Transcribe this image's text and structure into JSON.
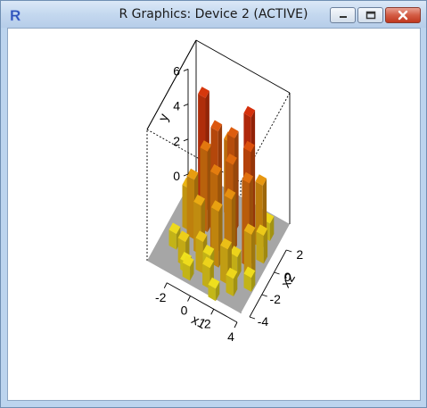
{
  "window": {
    "title": "R Graphics: Device 2 (ACTIVE)",
    "icon": "r-logo-icon",
    "controls": [
      "minimize-icon",
      "maximize-icon",
      "close-icon"
    ]
  },
  "chart_data": {
    "type": "3d-bar",
    "xlabel": "x1",
    "ylabel": "x2",
    "zlabel": "y",
    "x_ticks": [
      "-2",
      "0",
      "2",
      "4"
    ],
    "y_ticks": [
      "-4",
      "-2",
      "0",
      "2"
    ],
    "z_ticks": [
      "0",
      "2",
      "4",
      "6"
    ],
    "zlim": [
      0,
      7
    ],
    "colors": {
      "low": "#f0f020",
      "mid": "#e89a10",
      "high": "#d42a0c",
      "floor": "#a6a6a6"
    },
    "bars": [
      {
        "x1": -2.2,
        "x2": 1.8,
        "y": 6.6
      },
      {
        "x1": 1.6,
        "x2": 2.0,
        "y": 6.8
      },
      {
        "x1": -0.8,
        "x2": 1.2,
        "y": 5.6
      },
      {
        "x1": 0.4,
        "x2": 1.6,
        "y": 5.4
      },
      {
        "x1": 2.2,
        "x2": 0.8,
        "y": 5.8
      },
      {
        "x1": 1.0,
        "x2": 0.2,
        "y": 5.0
      },
      {
        "x1": -1.4,
        "x2": 0.6,
        "y": 4.6
      },
      {
        "x1": 0.0,
        "x2": -0.4,
        "y": 4.4
      },
      {
        "x1": 2.6,
        "x2": -0.2,
        "y": 4.8
      },
      {
        "x1": -0.4,
        "x2": 2.6,
        "y": 4.2
      },
      {
        "x1": 1.4,
        "x2": -0.8,
        "y": 3.8
      },
      {
        "x1": -2.0,
        "x2": -0.4,
        "y": 3.4
      },
      {
        "x1": 0.6,
        "x2": -1.4,
        "y": 3.2
      },
      {
        "x1": 2.8,
        "x2": 1.6,
        "y": 3.6
      },
      {
        "x1": -1.0,
        "x2": -1.2,
        "y": 2.8
      },
      {
        "x1": 3.2,
        "x2": -1.0,
        "y": 2.6
      },
      {
        "x1": -2.6,
        "x2": 0.0,
        "y": 2.4
      },
      {
        "x1": 1.8,
        "x2": -2.2,
        "y": 2.0
      },
      {
        "x1": -0.2,
        "x2": -2.4,
        "y": 1.8
      },
      {
        "x1": 3.4,
        "x2": 0.6,
        "y": 1.6
      },
      {
        "x1": -1.6,
        "x2": -2.6,
        "y": 1.4
      },
      {
        "x1": 0.8,
        "x2": -3.2,
        "y": 1.2
      },
      {
        "x1": 2.6,
        "x2": -2.8,
        "y": 1.0
      },
      {
        "x1": -2.8,
        "x2": -1.8,
        "y": 0.9
      },
      {
        "x1": -0.8,
        "x2": -3.4,
        "y": 0.8
      },
      {
        "x1": 1.6,
        "x2": -3.8,
        "y": 0.7
      },
      {
        "x1": 3.6,
        "x2": -1.8,
        "y": 0.8
      },
      {
        "x1": 3.0,
        "x2": 2.4,
        "y": 1.0
      },
      {
        "x1": -1.2,
        "x2": -3.0,
        "y": 0.6
      },
      {
        "x1": 0.2,
        "x2": -2.0,
        "y": 0.9
      },
      {
        "x1": 2.2,
        "x2": -1.4,
        "y": 1.2
      },
      {
        "x1": -2.4,
        "x2": 2.6,
        "y": 1.1
      }
    ]
  }
}
